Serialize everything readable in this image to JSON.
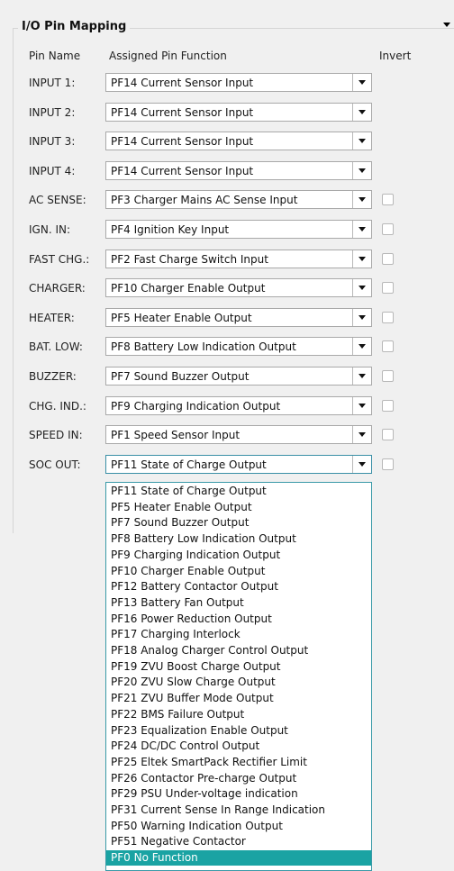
{
  "group": {
    "title": "I/O Pin Mapping"
  },
  "headers": {
    "pin_name": "Pin Name",
    "function": "Assigned Pin Function",
    "invert": "Invert"
  },
  "rows": [
    {
      "label": "INPUT 1:",
      "value": "PF14 Current Sensor Input",
      "invert": null
    },
    {
      "label": "INPUT 2:",
      "value": "PF14 Current Sensor Input",
      "invert": null
    },
    {
      "label": "INPUT 3:",
      "value": "PF14 Current Sensor Input",
      "invert": null
    },
    {
      "label": "INPUT 4:",
      "value": "PF14 Current Sensor Input",
      "invert": null
    },
    {
      "label": "AC SENSE:",
      "value": "PF3 Charger Mains AC Sense Input",
      "invert": false
    },
    {
      "label": "IGN. IN:",
      "value": "PF4 Ignition Key Input",
      "invert": false
    },
    {
      "label": "FAST CHG.:",
      "value": "PF2 Fast Charge Switch Input",
      "invert": false
    },
    {
      "label": "CHARGER:",
      "value": "PF10 Charger Enable Output",
      "invert": false
    },
    {
      "label": "HEATER:",
      "value": "PF5 Heater Enable Output",
      "invert": false
    },
    {
      "label": "BAT. LOW:",
      "value": "PF8 Battery Low Indication Output",
      "invert": false
    },
    {
      "label": "BUZZER:",
      "value": "PF7 Sound Buzzer Output",
      "invert": false
    },
    {
      "label": "CHG. IND.:",
      "value": "PF9 Charging Indication Output",
      "invert": false
    },
    {
      "label": "SPEED IN:",
      "value": "PF1 Speed Sensor Input",
      "invert": false
    },
    {
      "label": "SOC OUT:",
      "value": "PF11 State of Charge Output",
      "invert": false,
      "open": true
    }
  ],
  "dropdown": {
    "options": [
      "PF11 State of Charge Output",
      "PF5 Heater Enable Output",
      "PF7 Sound Buzzer Output",
      "PF8 Battery Low Indication Output",
      "PF9 Charging Indication Output",
      "PF10 Charger Enable Output",
      "PF12 Battery Contactor Output",
      "PF13 Battery Fan Output",
      "PF16 Power Reduction Output",
      "PF17 Charging Interlock",
      "PF18 Analog Charger Control Output",
      "PF19 ZVU Boost Charge Output",
      "PF20 ZVU Slow Charge Output",
      "PF21 ZVU Buffer Mode Output",
      "PF22 BMS Failure Output",
      "PF23 Equalization Enable Output",
      "PF24 DC/DC Control Output",
      "PF25 Eltek SmartPack Rectifier Limit",
      "PF26 Contactor Pre-charge Output",
      "PF29 PSU Under-voltage indication",
      "PF31 Current Sense In Range Indication",
      "PF50 Warning Indication Output",
      "PF51 Negative Contactor",
      "PF0 No Function"
    ],
    "highlighted": "PF0 No Function"
  },
  "colors": {
    "highlight": "#1aa3a3",
    "focus_border": "#3a9aa8",
    "window_bg": "#f0f0f0"
  }
}
